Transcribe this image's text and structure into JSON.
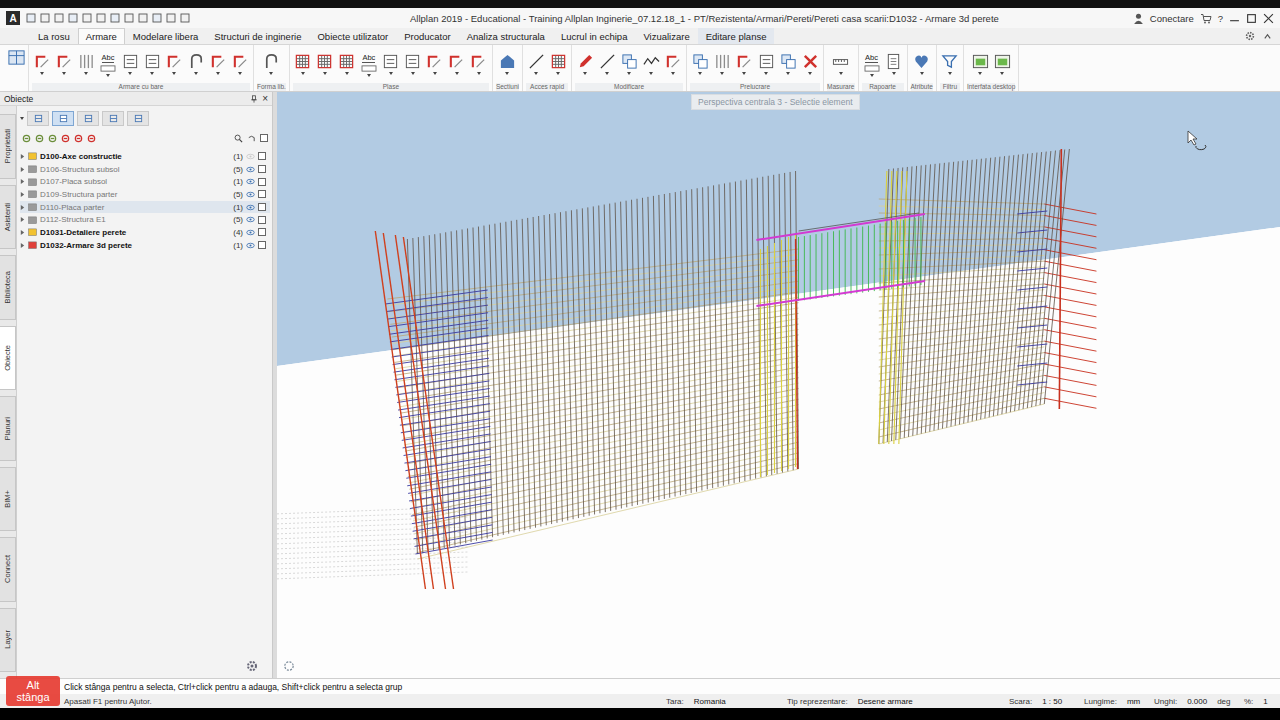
{
  "window": {
    "logo": "A",
    "title": "Allplan 2019 - Educational - Training Allplan Inginerie_07.12.18_1 - PT/Rezistenta/Armari/Pereti/Pereti casa scarii:D1032 - Armare 3d perete",
    "account": "Conectare",
    "help": "?"
  },
  "ribbon": {
    "tabs": [
      {
        "label": "La rosu",
        "selected": false,
        "highlighted": false
      },
      {
        "label": "Armare",
        "selected": true,
        "highlighted": false
      },
      {
        "label": "Modelare libera",
        "selected": false,
        "highlighted": false
      },
      {
        "label": "Structuri de inginerie",
        "selected": false,
        "highlighted": false
      },
      {
        "label": "Obiecte utilizator",
        "selected": false,
        "highlighted": false
      },
      {
        "label": "Producator",
        "selected": false,
        "highlighted": false
      },
      {
        "label": "Analiza structurala",
        "selected": false,
        "highlighted": false
      },
      {
        "label": "Lucrul in echipa",
        "selected": false,
        "highlighted": false
      },
      {
        "label": "Vizualizare",
        "selected": false,
        "highlighted": false
      },
      {
        "label": "Editare planse",
        "selected": false,
        "highlighted": true
      }
    ],
    "groups": [
      {
        "label": "Armare cu bare",
        "tools": [
          {
            "kind": "bar"
          },
          {
            "kind": "bar"
          },
          {
            "kind": "bars3d"
          },
          {
            "kind": "label",
            "text": "Abc"
          },
          {
            "kind": "sheet"
          },
          {
            "kind": "sheet"
          },
          {
            "kind": "bar"
          },
          {
            "kind": "shape"
          },
          {
            "kind": "bar"
          },
          {
            "kind": "bar"
          }
        ]
      },
      {
        "label": "Forma lib.",
        "tools": [
          {
            "kind": "shape"
          }
        ]
      },
      {
        "label": "Plase",
        "tools": [
          {
            "kind": "mesh"
          },
          {
            "kind": "mesh"
          },
          {
            "kind": "mesh"
          },
          {
            "kind": "label",
            "text": "Abc"
          },
          {
            "kind": "sheet"
          },
          {
            "kind": "sheet"
          },
          {
            "kind": "bar"
          },
          {
            "kind": "bar"
          },
          {
            "kind": "bar"
          }
        ]
      },
      {
        "label": "Sectiuni",
        "tools": [
          {
            "kind": "section"
          }
        ]
      },
      {
        "label": "Acces rapid",
        "tools": [
          {
            "kind": "line"
          },
          {
            "kind": "mesh"
          }
        ]
      },
      {
        "label": "Modificare",
        "tools": [
          {
            "kind": "edit"
          },
          {
            "kind": "line"
          },
          {
            "kind": "copy"
          },
          {
            "kind": "curve"
          },
          {
            "kind": "bar"
          }
        ]
      },
      {
        "label": "Prelucrare",
        "tools": [
          {
            "kind": "copy"
          },
          {
            "kind": "bars3d"
          },
          {
            "kind": "bar"
          },
          {
            "kind": "sheet"
          },
          {
            "kind": "copy"
          },
          {
            "kind": "delete"
          }
        ]
      },
      {
        "label": "Masurare",
        "tools": [
          {
            "kind": "measure"
          }
        ]
      },
      {
        "label": "Rapoarte",
        "tools": [
          {
            "kind": "label",
            "text": "Abc"
          },
          {
            "kind": "report"
          }
        ]
      },
      {
        "label": "Atribute",
        "tools": [
          {
            "kind": "attribute"
          }
        ]
      },
      {
        "label": "Filtru",
        "tools": [
          {
            "kind": "filter"
          }
        ]
      },
      {
        "label": "Interfata desktop",
        "tools": [
          {
            "kind": "desktop"
          },
          {
            "kind": "desktop"
          }
        ]
      }
    ]
  },
  "objects_panel": {
    "title": "Obiecte",
    "close": "×",
    "side_tabs": [
      {
        "label": "Proprietati",
        "selected": false
      },
      {
        "label": "Asistenti",
        "selected": false
      },
      {
        "label": "Biblioteca",
        "selected": false
      },
      {
        "label": "Obiecte",
        "selected": true
      },
      {
        "label": "Planuri",
        "selected": false
      },
      {
        "label": "BIM+",
        "selected": false
      },
      {
        "label": "Connect",
        "selected": false
      },
      {
        "label": "Layer",
        "selected": false
      }
    ],
    "items": [
      {
        "name": "D100-Axe constructie",
        "count": "(1)",
        "color": "#f2c230",
        "active": true,
        "selected": false,
        "visible": false
      },
      {
        "name": "D106-Structura subsol",
        "count": "(5)",
        "color": "#9a9a9a",
        "active": false,
        "selected": false,
        "visible": true
      },
      {
        "name": "D107-Placa subsol",
        "count": "(1)",
        "color": "#9a9a9a",
        "active": false,
        "selected": false,
        "visible": true
      },
      {
        "name": "D109-Structura parter",
        "count": "(5)",
        "color": "#9a9a9a",
        "active": false,
        "selected": false,
        "visible": true
      },
      {
        "name": "D110-Placa parter",
        "count": "(1)",
        "color": "#9a9a9a",
        "active": false,
        "selected": true,
        "visible": true
      },
      {
        "name": "D112-Structura E1",
        "count": "(5)",
        "color": "#9a9a9a",
        "active": false,
        "selected": false,
        "visible": true
      },
      {
        "name": "D1031-Detaliere perete",
        "count": "(4)",
        "color": "#f2c230",
        "active": true,
        "selected": false,
        "visible": true
      },
      {
        "name": "D1032-Armare 3d perete",
        "count": "(1)",
        "color": "#e0403a",
        "active": true,
        "selected": false,
        "visible": true
      }
    ]
  },
  "viewport": {
    "label": "Perspectiva centrala 3 - Selectie element"
  },
  "status": {
    "hint": "Click stânga pentru a selecta, Ctrl+click pentru a adauga, Shift+click pentru a selecta grup",
    "help": "Apasati F1 pentru Ajutor.",
    "fields": [
      {
        "label": "Tara:",
        "value": "Romania",
        "unit": ""
      },
      {
        "label": "Tip reprezentare:",
        "value": "Desene armare",
        "unit": ""
      },
      {
        "label": "Scara:",
        "value": "1 : 50",
        "unit": ""
      },
      {
        "label": "Lungime:",
        "value": "mm",
        "unit": ""
      },
      {
        "label": "Unghi:",
        "value": "0.000",
        "unit": "deg"
      },
      {
        "label": "%:",
        "value": "1",
        "unit": ""
      }
    ]
  },
  "key_badge": {
    "lines": [
      "Alt",
      "stânga"
    ]
  }
}
